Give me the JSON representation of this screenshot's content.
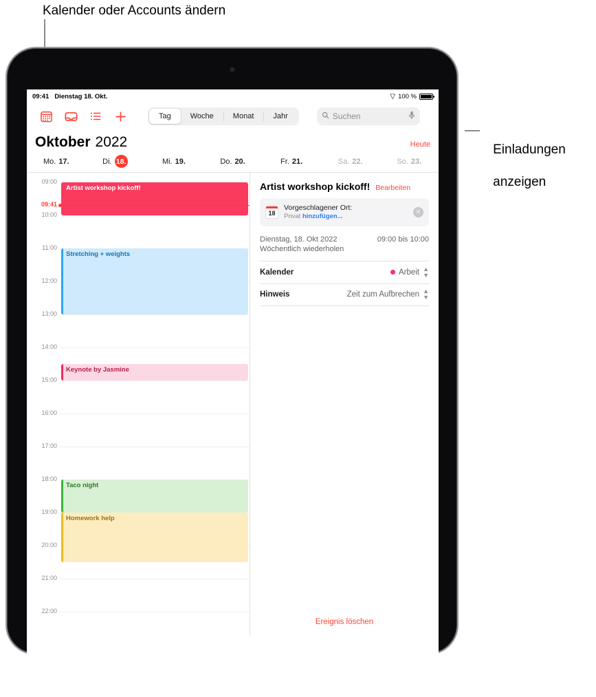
{
  "callouts": {
    "top": "Kalender oder Accounts ändern",
    "right_line1": "Einladungen",
    "right_line2": "anzeigen"
  },
  "status_bar": {
    "time": "09:41",
    "date": "Dienstag 18. Okt.",
    "wifi_icon": "wifi-icon",
    "battery_percent": "100 %"
  },
  "toolbar": {
    "icons": [
      {
        "name": "calendars-icon",
        "label": "Kalender"
      },
      {
        "name": "inbox-icon",
        "label": "Einladungen"
      },
      {
        "name": "list-icon",
        "label": "Liste"
      },
      {
        "name": "add-event-icon",
        "label": "Neues Ereignis"
      }
    ],
    "segments": [
      {
        "label": "Tag",
        "active": true
      },
      {
        "label": "Woche",
        "active": false
      },
      {
        "label": "Monat",
        "active": false
      },
      {
        "label": "Jahr",
        "active": false
      }
    ],
    "search": {
      "placeholder": "Suchen",
      "search_icon": "search-icon",
      "mic_icon": "microphone-icon"
    }
  },
  "header": {
    "month": "Oktober",
    "year": "2022",
    "today_label": "Heute"
  },
  "weekdays": [
    {
      "name": "Mo.",
      "day": "17.",
      "today": false,
      "dim": false
    },
    {
      "name": "Di.",
      "day": "18.",
      "today": true,
      "dim": false
    },
    {
      "name": "Mi.",
      "day": "19.",
      "today": false,
      "dim": false
    },
    {
      "name": "Do.",
      "day": "20.",
      "today": false,
      "dim": false
    },
    {
      "name": "Fr.",
      "day": "21.",
      "today": false,
      "dim": false
    },
    {
      "name": "Sa.",
      "day": "22.",
      "today": false,
      "dim": true
    },
    {
      "name": "So.",
      "day": "23.",
      "today": false,
      "dim": true
    }
  ],
  "timeline": {
    "hours": [
      "09:00",
      "10:00",
      "11:00",
      "12:00",
      "13:00",
      "14:00",
      "15:00",
      "16:00",
      "17:00",
      "18:00",
      "19:00",
      "20:00",
      "21:00",
      "22:00"
    ],
    "now_label": "09:41",
    "events": [
      {
        "title": "Artist workshop kickoff!",
        "start": "09:00",
        "end": "10:00",
        "bg": "#fa3a5e",
        "text": "#ffffff",
        "bar": "#fa3a5e"
      },
      {
        "title": "Stretching + weights",
        "start": "11:00",
        "end": "13:00",
        "bg": "#cfeafc",
        "text": "#1576b8",
        "bar": "#2ca7f0"
      },
      {
        "title": "Keynote by Jasmine",
        "start": "14:30",
        "end": "15:00",
        "bg": "#fcd8e4",
        "text": "#b2214a",
        "bar": "#f2295f"
      },
      {
        "title": "Taco night",
        "start": "18:00",
        "end": "19:00",
        "bg": "#d8f0d4",
        "text": "#2b7a2b",
        "bar": "#3bb23b"
      },
      {
        "title": "Homework help",
        "start": "19:00",
        "end": "20:30",
        "bg": "#fcecc0",
        "text": "#9a7410",
        "bar": "#f0b823"
      }
    ]
  },
  "detail": {
    "title": "Artist workshop kickoff!",
    "edit_label": "Bearbeiten",
    "suggestion": {
      "mini_cal_day": "18",
      "line1": "Vorgeschlagener Ort:",
      "line2_prefix": "Privat ",
      "line2_link": "hinzufügen...",
      "close_icon": "close-icon"
    },
    "when": {
      "date": "Dienstag, 18. Okt 2022",
      "time": "09:00 bis 10:00",
      "repeat": "Wöchentlich wiederholen"
    },
    "rows": [
      {
        "label": "Kalender",
        "value": "Arbeit",
        "dot_color": "#ff2d6f",
        "has_dot": true,
        "stepper": true
      },
      {
        "label": "Hinweis",
        "value": "Zeit zum Aufbrechen",
        "dot_color": "",
        "has_dot": false,
        "stepper": true
      }
    ],
    "delete_label": "Ereignis löschen"
  }
}
